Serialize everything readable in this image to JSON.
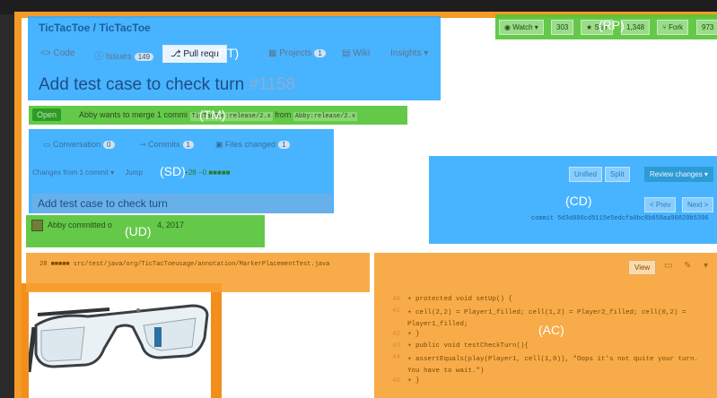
{
  "repo": {
    "title": "TicTacToe / TicTacToe"
  },
  "header_actions": {
    "watch": {
      "label": "Watch",
      "count": "303"
    },
    "star": {
      "label": "Star",
      "count": "1,348"
    },
    "fork": {
      "label": "Fork",
      "count": "973"
    }
  },
  "tabs": [
    {
      "label": "Code"
    },
    {
      "label": "Issues",
      "count": "149"
    },
    {
      "label": "Pull requ"
    },
    {
      "label": "Projects",
      "count": "1"
    },
    {
      "label": "Wiki"
    },
    {
      "label": "Insights"
    }
  ],
  "pr": {
    "title": "Add test case to check turn",
    "number": "#1158"
  },
  "merge_bar": {
    "status": "Open",
    "text_prefix": "Abby wants to merge 1 commi",
    "target_branch": "TicTacToe:release/2.x",
    "from_word": "from",
    "source_branch": "Abby:release/2.x"
  },
  "subtabs": [
    {
      "label": "Conversation",
      "count": "0"
    },
    {
      "label": "Commits",
      "count": "1"
    },
    {
      "label": "Files changed",
      "count": "1"
    }
  ],
  "changes_line": {
    "from": "Changes from 1 commit",
    "jump": "Jump",
    "stats": "+28 −0"
  },
  "commit": {
    "title": "Add test case to check turn",
    "author_text": "Abby committed o",
    "date_suffix": "4, 2017"
  },
  "diff_controls": {
    "unified": "Unified",
    "split": "Split",
    "review": "Review changes",
    "prev": "< Prev",
    "next": "Next >",
    "commit_id": "commit 5d3d086cd5115e5edcfa0bc8b658aa90820b5396"
  },
  "file": {
    "path": "28 ■■■■■ src/test/java/org/TicTacToeusage/annotation/MarkerPlacementTest.java",
    "view_label": "View"
  },
  "code_lines": [
    {
      "num": "40",
      "text": "+     protected void setUp() {"
    },
    {
      "num": "41",
      "text": "+       cell(2,2) = Player1_filled; cell(1,2) = Player2_filled; cell(0,2) = Player1_filled;"
    },
    {
      "num": "42",
      "text": "+  }"
    },
    {
      "num": "43",
      "text": "+   public void testCheckTurn(){"
    },
    {
      "num": "44",
      "text": "+    assertEquals(play(Player1, cell(1,0)), \"Oops it's not quite your turn. You have to wait.\")"
    },
    {
      "num": "45",
      "text": "+  }"
    }
  ],
  "region_labels": {
    "PT": "(PT)",
    "RP": "(RP)",
    "TM": "(TM)",
    "SD": "(SD)",
    "CD": "(CD)",
    "UD": "(UD)",
    "AC": "(AC)"
  },
  "colors": {
    "blue_overlay": "#2faaff",
    "green_overlay": "#57c43a",
    "orange_overlay": "#f7a030"
  }
}
